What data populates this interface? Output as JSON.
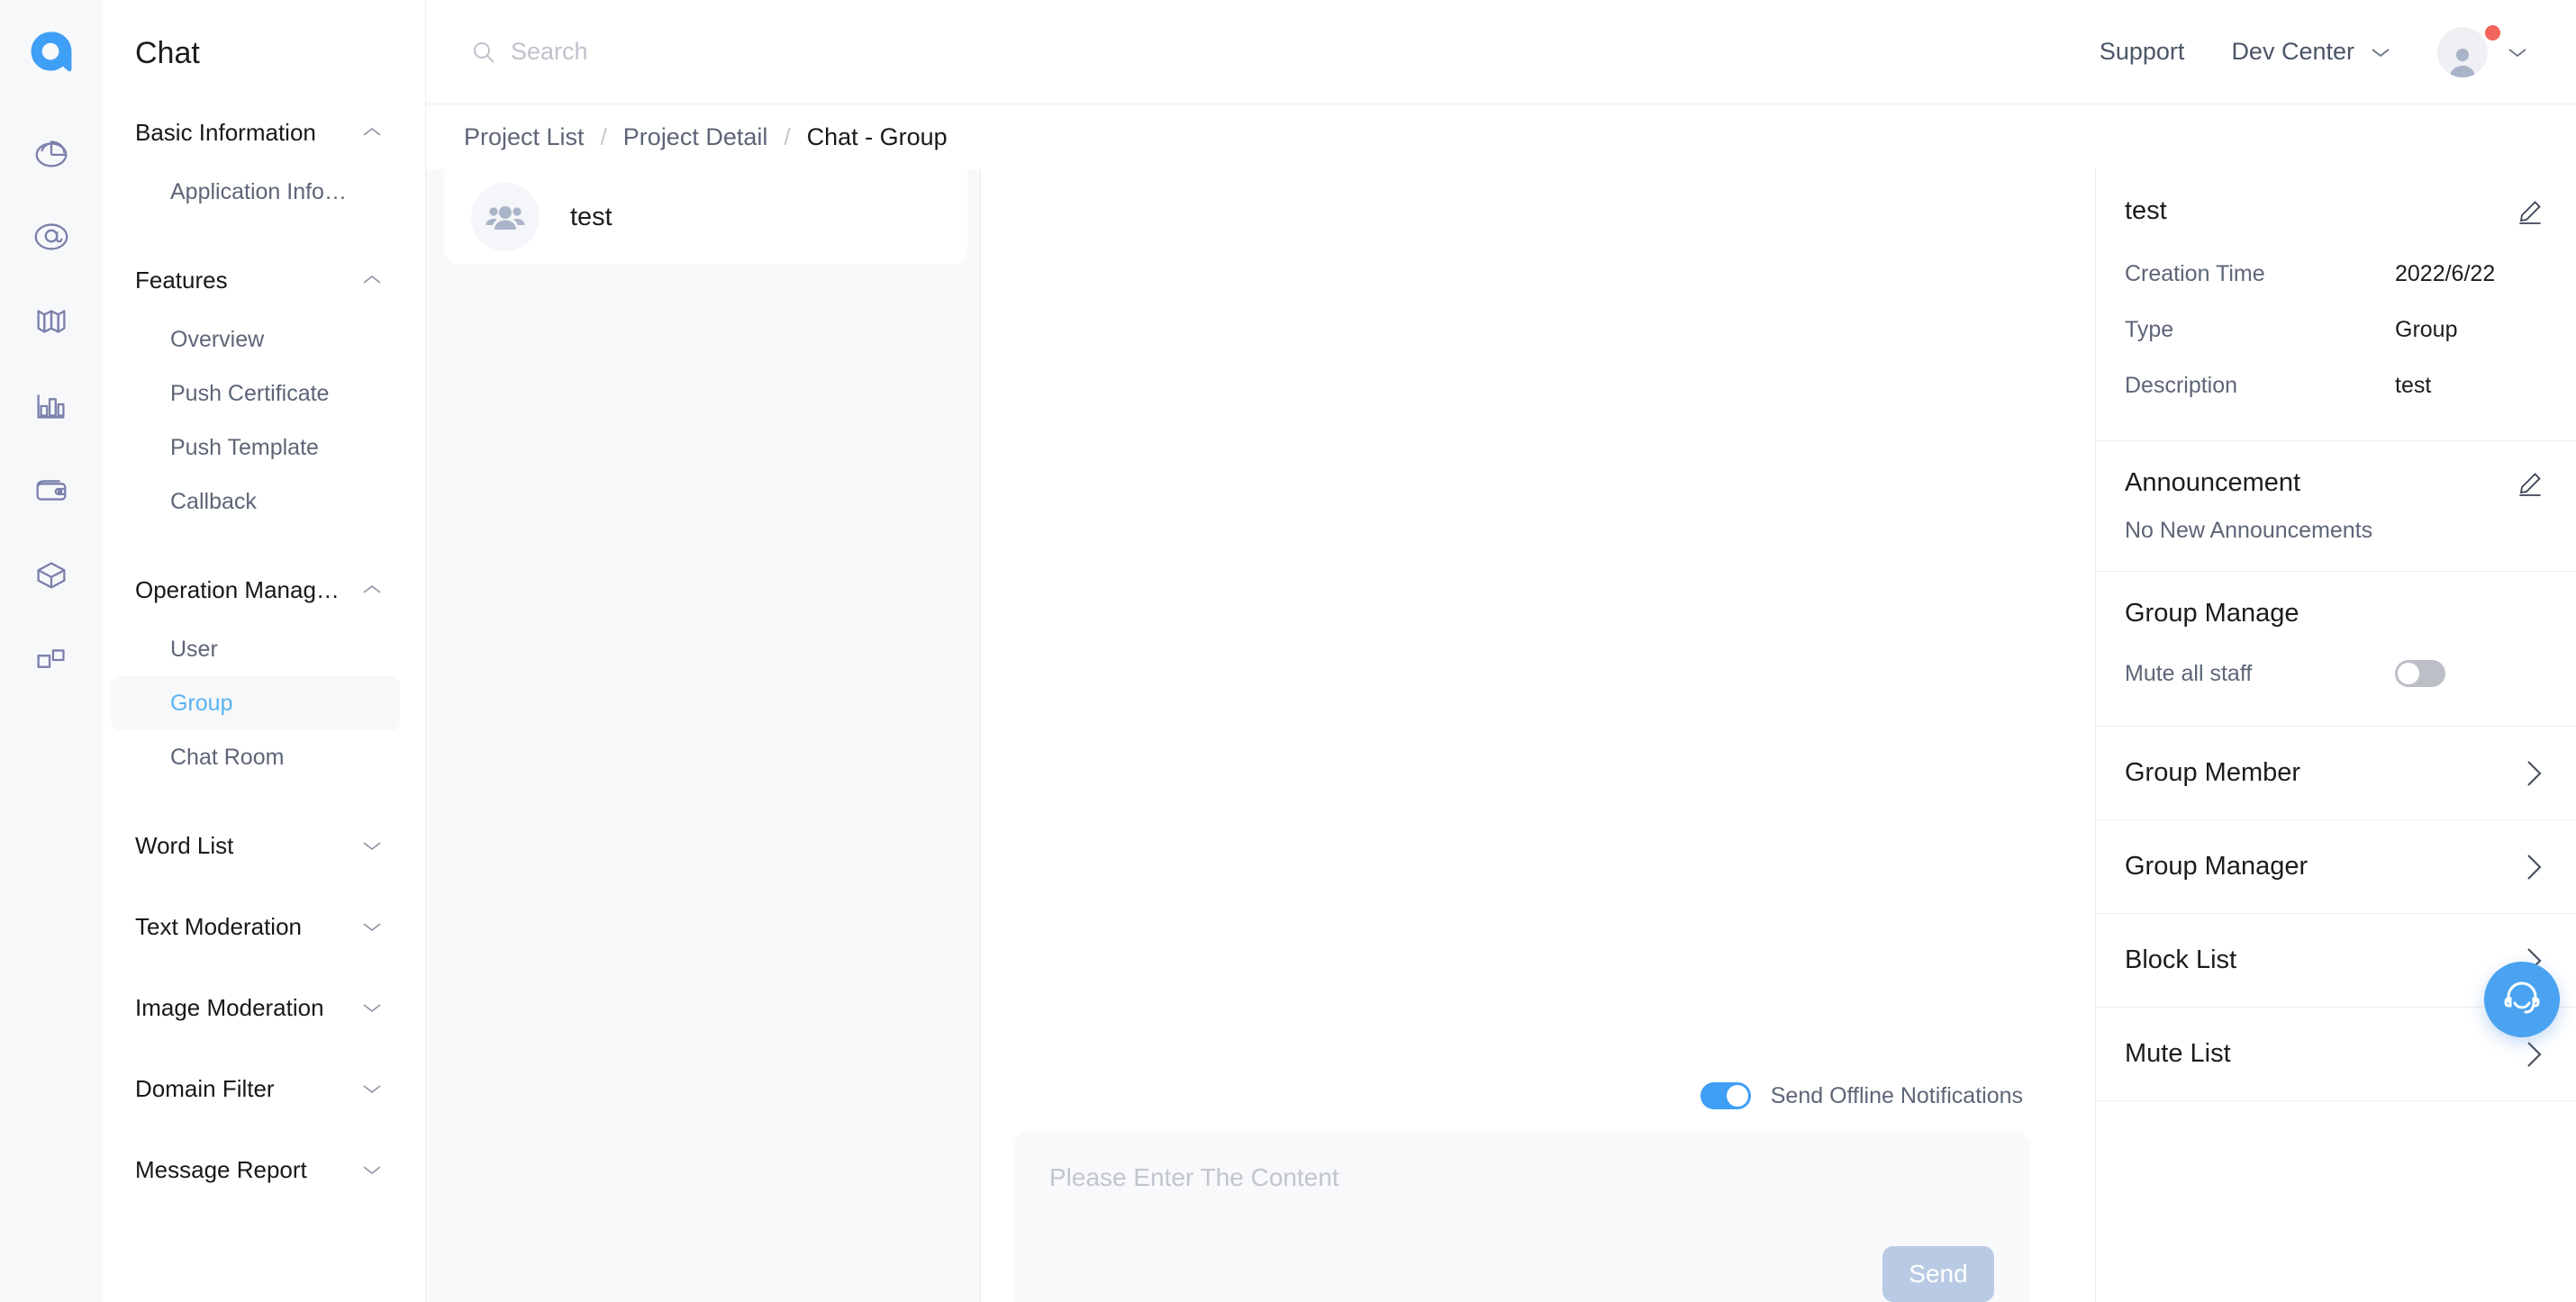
{
  "brand": {
    "logo_alt": "a",
    "accent": "#3f9ef5",
    "active_nav_color": "#58b2f0"
  },
  "rail": {
    "items": [
      {
        "icon": "pie-chart-icon",
        "name": "rail-item-analytics"
      },
      {
        "icon": "at-mention-icon",
        "name": "rail-item-mention"
      },
      {
        "icon": "book-icon",
        "name": "rail-item-docs"
      },
      {
        "icon": "bar-chart-icon",
        "name": "rail-item-statistics"
      },
      {
        "icon": "wallet-icon",
        "name": "rail-item-billing"
      },
      {
        "icon": "package-icon",
        "name": "rail-item-products"
      },
      {
        "icon": "grid-apps-icon",
        "name": "rail-item-apps"
      }
    ]
  },
  "sidebar": {
    "title": "Chat",
    "groups": [
      {
        "label": "Basic Information",
        "expanded": true,
        "items": [
          {
            "label": "Application Info…",
            "active": false
          }
        ]
      },
      {
        "label": "Features",
        "expanded": true,
        "items": [
          {
            "label": "Overview",
            "active": false
          },
          {
            "label": "Push Certificate",
            "active": false
          },
          {
            "label": "Push Template",
            "active": false
          },
          {
            "label": "Callback",
            "active": false
          }
        ]
      },
      {
        "label": "Operation Manag…",
        "expanded": true,
        "items": [
          {
            "label": "User",
            "active": false
          },
          {
            "label": "Group",
            "active": true
          },
          {
            "label": "Chat Room",
            "active": false
          }
        ]
      },
      {
        "label": "Word List",
        "expanded": false,
        "items": []
      },
      {
        "label": "Text Moderation",
        "expanded": false,
        "items": []
      },
      {
        "label": "Image Moderation",
        "expanded": false,
        "items": []
      },
      {
        "label": "Domain Filter",
        "expanded": false,
        "items": []
      },
      {
        "label": "Message Report",
        "expanded": false,
        "items": []
      }
    ]
  },
  "topbar": {
    "search": {
      "value": "",
      "placeholder": "Search"
    },
    "support_label": "Support",
    "dev_center_label": "Dev Center",
    "has_notification": true
  },
  "breadcrumb": {
    "items": [
      {
        "label": "Project List",
        "current": false
      },
      {
        "label": "Project Detail",
        "current": false
      },
      {
        "label": "Chat - Group",
        "current": true
      }
    ],
    "separator": "/"
  },
  "group_list": {
    "items": [
      {
        "name": "test",
        "avatar": "group-avatar-icon",
        "selected": true
      }
    ]
  },
  "chat": {
    "offline_toggle": {
      "label": "Send Offline Notifications",
      "on": true
    },
    "composer": {
      "value": "",
      "placeholder": "Please Enter The Content"
    },
    "send_label": "Send",
    "send_disabled": true
  },
  "detail": {
    "info": {
      "title": "test",
      "edit_icon": "pencil-icon",
      "rows": [
        {
          "key": "Creation Time",
          "value": "2022/6/22"
        },
        {
          "key": "Type",
          "value": "Group"
        },
        {
          "key": "Description",
          "value": "test"
        }
      ]
    },
    "announcement": {
      "title": "Announcement",
      "edit_icon": "pencil-icon",
      "empty_text": "No New Announcements"
    },
    "group_manage": {
      "title": "Group Manage",
      "mute_label": "Mute all staff",
      "mute_on": false
    },
    "nav_rows": [
      {
        "label": "Group Member"
      },
      {
        "label": "Group Manager"
      },
      {
        "label": "Block List"
      },
      {
        "label": "Mute List"
      }
    ]
  },
  "fab": {
    "icon": "headset-support-icon"
  }
}
